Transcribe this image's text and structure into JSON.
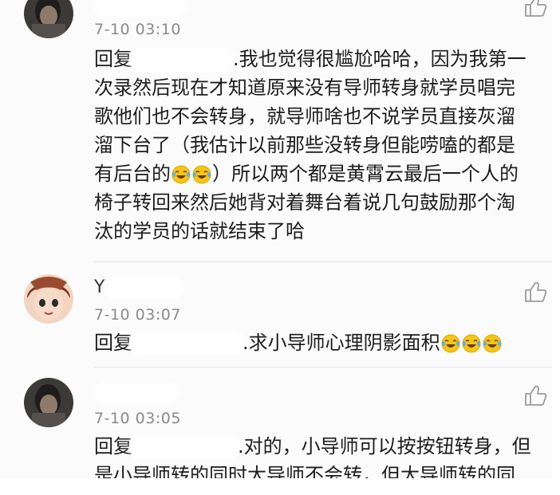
{
  "comments": [
    {
      "time": "7-10 03:10",
      "reply_prefix": "回复",
      "lines": [
        ".我也觉得很尴尬哈哈，因为我第一",
        "次录然后现在才知道原来没有导师转身就学员唱完",
        "歌他们也不会转身，就导师啥也不说学员直接灰溜",
        "溜下台了（我估计以前那些没转身但能唠嗑的都是",
        "有后台的",
        "）所以两个都是黄霄云最后一个人的",
        "椅子转回来然后她背对着舞台着说几句鼓励那个淘",
        "汰的学员的话就结束了哈"
      ]
    },
    {
      "time": "7-10 03:07",
      "reply_prefix": "回复",
      "username_start": "Y",
      "text": ".求小导师心理阴影面积"
    },
    {
      "time": "7-10 03:05",
      "reply_prefix": "回复",
      "lines": [
        ".对的，小导师可以按按钮转身，但",
        "是小导师转的同时大导师不会转，但大导师转的同"
      ]
    }
  ],
  "icons": {
    "like": "thumbs-up-icon",
    "emoji": "laughing-crying-emoji"
  },
  "colors": {
    "time": "#8a8a8a",
    "text": "#1c1c1c",
    "emoji": "#f5c518"
  }
}
